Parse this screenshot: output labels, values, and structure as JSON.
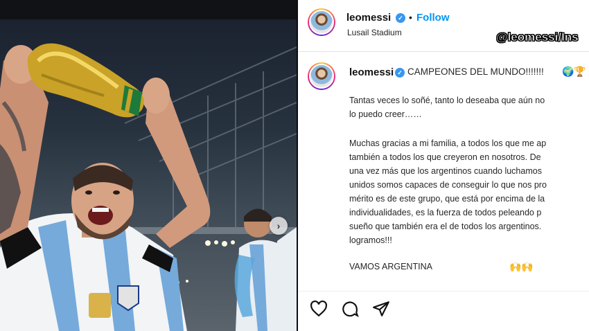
{
  "post": {
    "username": "leomessi",
    "follow_label": "Follow",
    "separator": "•",
    "location": "Lusail Stadium",
    "caption_title": "CAMPEONES DEL MUNDO!!!!!!!",
    "caption_emojis": "🌍🏆",
    "caption_p1": "Tantas veces lo soñé, tanto lo deseaba que aún no\nlo puedo creer……",
    "caption_p2": "Muchas gracias a mi familia, a todos los que me ap\ntambién a todos los que creyeron en nosotros. De\nuna vez más que los argentinos cuando luchamos\nunidos somos capaces de conseguir lo que nos pro\nmérito es de este grupo, que está por encima de la\nindividualidades, es la fuerza de todos peleando p\nsueño que también era el de todos los argentinos.\nlogramos!!!",
    "caption_closing": "VAMOS ARGENTINA",
    "closing_emojis": "🙌🙌"
  },
  "overlay": {
    "watermark": "@leomessi/Ins"
  },
  "icons": {
    "verified": "verified-badge-icon",
    "carousel": "chevron-right-icon",
    "like": "heart-icon",
    "comment": "comment-icon",
    "share": "paper-plane-icon"
  },
  "colors": {
    "follow": "#0095f6",
    "verified": "#3897f0",
    "trophy_gold": "#c9a227",
    "argentina_blue": "#75aadb"
  }
}
